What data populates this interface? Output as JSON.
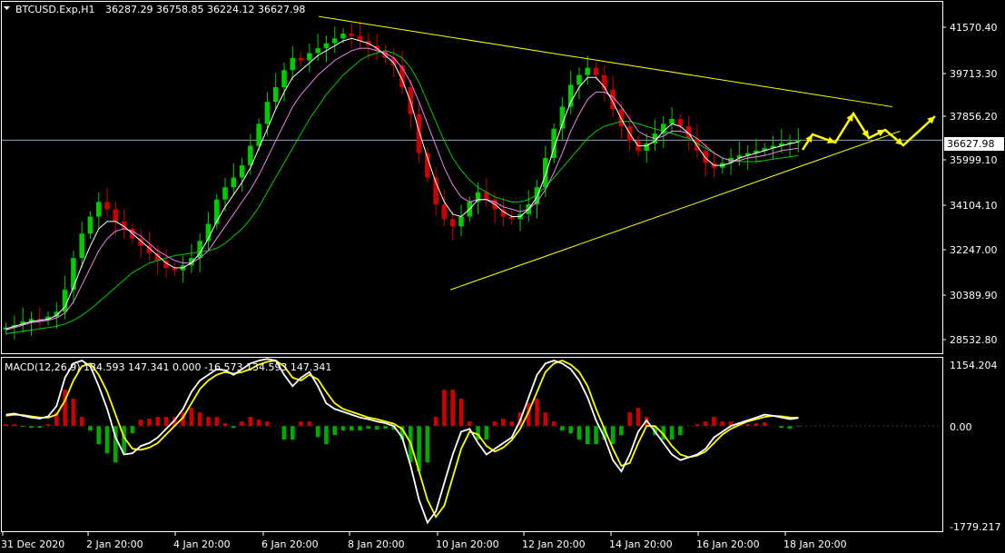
{
  "header": {
    "menu_icon": "triangle-down-icon",
    "symbol": "BTCUSD.Exp,H1",
    "ohlc": "36287.29 36758.85 36224.12 36627.98"
  },
  "macd_header": {
    "text": "MACD(12,26,9) 134.593 147.341 0.000 -16.573 134.593 147.341"
  },
  "current_price_label": "36627.98",
  "colors": {
    "background": "#000000",
    "bull_candle": "#00cc00",
    "bear_candle": "#cc0000",
    "ma_fast": "#ffffff",
    "ma_mid": "#ee82ee",
    "ma_slow": "#00cc00",
    "trendline": "#ffff00",
    "arrows": "#ffff00",
    "macd_line": "#ffffff",
    "signal_line": "#ffff00",
    "hist_up": "#cc0000",
    "hist_down": "#00aa00",
    "axis_frame": "#ffffff",
    "price_line": "#8ea5c9"
  },
  "chart_data": [
    {
      "type": "line",
      "panel": "price",
      "title": "BTCUSD.Exp,H1",
      "x_tick_labels": [
        "31 Dec 2020",
        "2 Jan 20:00",
        "4 Jan 20:00",
        "6 Jan 20:00",
        "8 Jan 20:00",
        "10 Jan 20:00",
        "12 Jan 20:00",
        "14 Jan 20:00",
        "16 Jan 20:00",
        "18 Jan 20:00"
      ],
      "y_tick_labels": [
        "41570.40",
        "39713.30",
        "37856.20",
        "35999.10",
        "34104.10",
        "32247.00",
        "30389.90",
        "28532.80"
      ],
      "ylim": [
        27900,
        42300
      ],
      "current_price": 36627.98,
      "series": [
        {
          "values": [
            28950,
            29050,
            29200,
            29300,
            29250,
            29400,
            29600,
            30500,
            31800,
            32800,
            33500,
            34100,
            33800,
            33300,
            33000,
            32600,
            32300,
            32000,
            31700,
            31400,
            31300,
            31500,
            31800,
            32500,
            33200,
            34200,
            34700,
            35100,
            35600,
            36400,
            37300,
            38200,
            38800,
            39500,
            40000,
            39900,
            40200,
            40400,
            40600,
            40800,
            41000,
            40900,
            40700,
            40500,
            40300,
            40000,
            39700,
            38800,
            37700,
            36100,
            35100,
            34000,
            33400,
            33100,
            33500,
            34100,
            34500,
            34200,
            33800,
            33500,
            33400,
            33600,
            34000,
            34700,
            35900,
            37100,
            38000,
            38900,
            39300,
            39600,
            39300,
            38700,
            37900,
            37200,
            36600,
            36200,
            36500,
            36900,
            37300,
            37500,
            37200,
            36700,
            36200,
            35700,
            35500,
            35700,
            35900,
            36000,
            36100,
            36200,
            36300,
            36400,
            36500,
            36550,
            36627
          ]
        }
      ],
      "moving_averages": [
        {
          "values": [
            28900,
            29000,
            29100,
            29200,
            29250,
            29300,
            29450,
            29800,
            30600,
            31500,
            32300,
            33000,
            33300,
            33300,
            33100,
            32800,
            32500,
            32200,
            31900,
            31600,
            31400,
            31400,
            31600,
            32000,
            32600,
            33300,
            33900,
            34400,
            34900,
            35500,
            36300,
            37100,
            37900,
            38600,
            39200,
            39500,
            39800,
            40100,
            40300,
            40500,
            40700,
            40800,
            40700,
            40600,
            40400,
            40100,
            39800,
            39100,
            38200,
            37000,
            35900,
            34900,
            34100,
            33600,
            33500,
            33800,
            34200,
            34200,
            34000,
            33700,
            33500,
            33500,
            33800,
            34300,
            35200,
            36300,
            37300,
            38200,
            38800,
            39200,
            39200,
            38800,
            38200,
            37500,
            36900,
            36400,
            36400,
            36600,
            37000,
            37300,
            37200,
            36900,
            36400,
            35900,
            35600,
            35600,
            35700,
            35900,
            36000,
            36100,
            36200,
            36300,
            36400,
            36480,
            36560
          ]
        },
        {
          "values": [
            28850,
            28950,
            29050,
            29150,
            29200,
            29250,
            29350,
            29550,
            30000,
            30700,
            31400,
            32100,
            32600,
            32900,
            33000,
            32900,
            32700,
            32400,
            32100,
            31900,
            31700,
            31600,
            31600,
            31800,
            32100,
            32600,
            33100,
            33600,
            34100,
            34600,
            35200,
            35900,
            36600,
            37300,
            38000,
            38500,
            38900,
            39300,
            39600,
            39900,
            40100,
            40300,
            40400,
            40400,
            40300,
            40200,
            40000,
            39600,
            39000,
            38200,
            37300,
            36400,
            35500,
            34800,
            34300,
            34100,
            34200,
            34200,
            34100,
            33900,
            33800,
            33700,
            33800,
            34100,
            34600,
            35300,
            36100,
            37000,
            37700,
            38300,
            38600,
            38600,
            38400,
            38000,
            37500,
            37000,
            36800,
            36700,
            36800,
            37000,
            37000,
            36900,
            36700,
            36400,
            36100,
            35900,
            35800,
            35800,
            35900,
            35950,
            36000,
            36100,
            36200,
            36250,
            36300
          ]
        },
        {
          "values": [
            28700,
            28750,
            28800,
            28850,
            28900,
            28950,
            29000,
            29100,
            29250,
            29450,
            29700,
            30000,
            30300,
            30600,
            30900,
            31200,
            31400,
            31600,
            31700,
            31800,
            31900,
            31950,
            32000,
            32050,
            32100,
            32200,
            32400,
            32700,
            33000,
            33400,
            33900,
            34500,
            35100,
            35700,
            36300,
            36900,
            37500,
            38000,
            38500,
            38900,
            39300,
            39600,
            39900,
            40100,
            40200,
            40300,
            40200,
            40000,
            39600,
            39000,
            38200,
            37400,
            36600,
            35900,
            35400,
            35000,
            34700,
            34500,
            34300,
            34200,
            34100,
            34100,
            34200,
            34400,
            34700,
            35100,
            35500,
            35900,
            36300,
            36700,
            37000,
            37200,
            37300,
            37400,
            37400,
            37300,
            37200,
            37100,
            37000,
            36900,
            36800,
            36700,
            36500,
            36300,
            36100,
            35900,
            35800,
            35750,
            35750,
            35750,
            35800,
            35850,
            35900,
            35950,
            36000
          ]
        }
      ],
      "trendlines": [
        {
          "from": [
            0.337,
            41700
          ],
          "to": [
            0.947,
            38000
          ]
        },
        {
          "from": [
            0.477,
            30500
          ],
          "to": [
            0.955,
            37000
          ]
        }
      ]
    },
    {
      "type": "line",
      "panel": "macd",
      "title": "MACD(12,26,9) 134.593 147.341 0.000 -16.573 134.593 147.341",
      "y_tick_labels": [
        "1154.204",
        "0.00",
        "-1779.217"
      ],
      "ylim": [
        -1850,
        1200
      ],
      "series": [
        {
          "name": "MACD",
          "values": [
            200,
            220,
            180,
            150,
            130,
            170,
            350,
            850,
            1100,
            1150,
            1050,
            700,
            300,
            -200,
            -500,
            -480,
            -350,
            -300,
            -200,
            -50,
            100,
            300,
            600,
            800,
            900,
            1000,
            980,
            900,
            1000,
            1100,
            1150,
            1180,
            1150,
            900,
            700,
            850,
            950,
            700,
            400,
            300,
            250,
            200,
            150,
            120,
            80,
            50,
            0,
            -200,
            -700,
            -1300,
            -1700,
            -1500,
            -1000,
            -500,
            -100,
            -50,
            -300,
            -500,
            -400,
            -300,
            -200,
            100,
            500,
            900,
            1100,
            1150,
            1100,
            1000,
            800,
            500,
            100,
            -200,
            -600,
            -800,
            -500,
            -100,
            100,
            -100,
            -300,
            -500,
            -600,
            -550,
            -500,
            -400,
            -200,
            -100,
            0,
            50,
            100,
            150,
            200,
            180,
            150,
            120,
            140
          ]
        },
        {
          "name": "Signal",
          "values": [
            180,
            200,
            190,
            170,
            150,
            150,
            200,
            450,
            800,
            1050,
            1100,
            900,
            600,
            200,
            -200,
            -400,
            -420,
            -380,
            -300,
            -150,
            0,
            150,
            400,
            650,
            800,
            900,
            950,
            920,
            950,
            1000,
            1080,
            1130,
            1150,
            1050,
            850,
            800,
            900,
            820,
            600,
            400,
            300,
            250,
            200,
            150,
            120,
            80,
            40,
            -50,
            -300,
            -800,
            -1300,
            -1600,
            -1400,
            -900,
            -400,
            -100,
            -150,
            -350,
            -450,
            -380,
            -250,
            -50,
            250,
            600,
            950,
            1100,
            1150,
            1080,
            950,
            700,
            300,
            -50,
            -400,
            -700,
            -650,
            -300,
            0,
            0,
            -150,
            -350,
            -500,
            -550,
            -520,
            -450,
            -300,
            -150,
            -50,
            20,
            80,
            120,
            160,
            180,
            170,
            150,
            147
          ]
        }
      ]
    }
  ]
}
